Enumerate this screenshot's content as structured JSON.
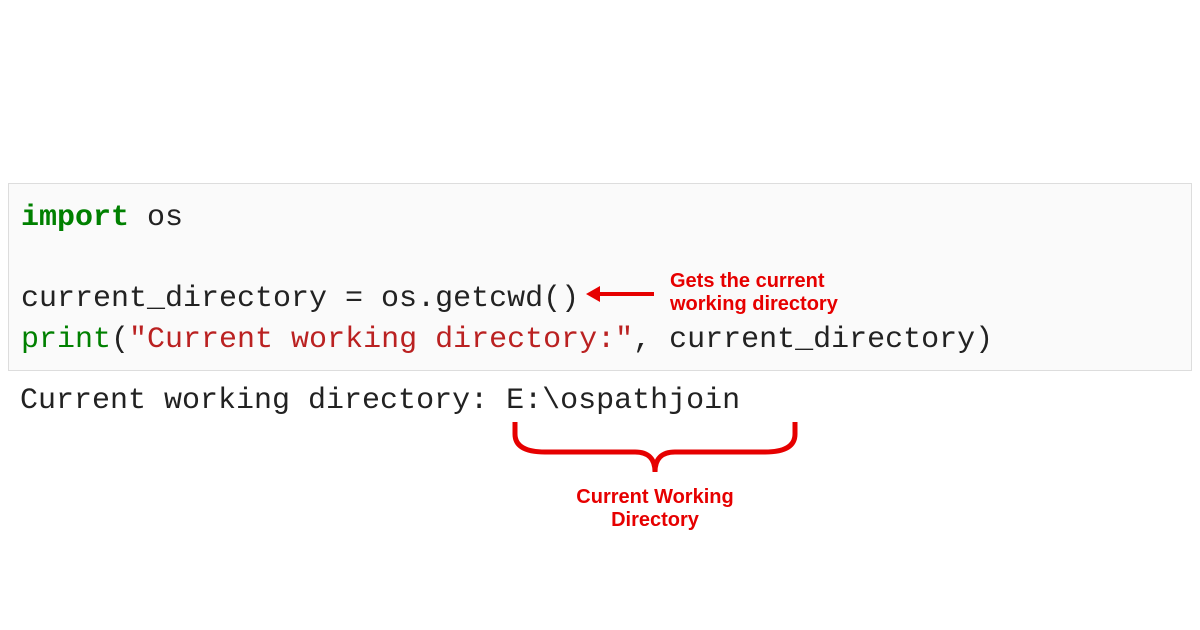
{
  "code": {
    "line1_kw": "import",
    "line1_rest": " os",
    "line2_a": "current_directory = os.getcwd()",
    "line3_pre": "print",
    "line3_paren_open": "(",
    "line3_str": "\"Current working directory:\"",
    "line3_rest": ", current_directory)"
  },
  "output": {
    "text": "Current working directory: E:\\ospathjoin"
  },
  "annotations": {
    "arrow_label_l1": "Gets the current",
    "arrow_label_l2": "working directory",
    "brace_label_l1": "Current Working",
    "brace_label_l2": "Directory"
  }
}
